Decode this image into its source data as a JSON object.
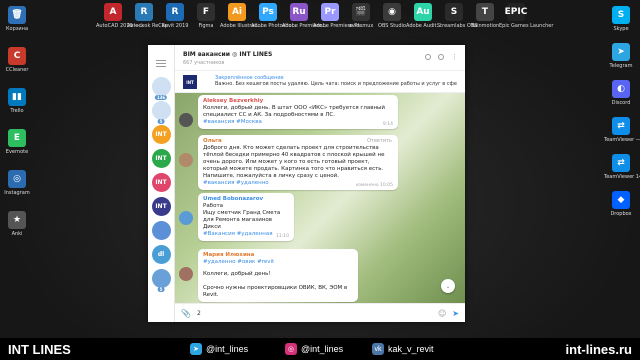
{
  "desktop_left": [
    {
      "label": "Корзина",
      "glyph": "🗑",
      "color": "#2e6fb5"
    },
    {
      "label": "CCleaner",
      "glyph": "C",
      "color": "#c83b2c"
    },
    {
      "label": "Trello",
      "glyph": "▮▮",
      "color": "#0079bf"
    },
    {
      "label": "Evernote",
      "glyph": "E",
      "color": "#2dbe60"
    },
    {
      "label": "Instagram",
      "glyph": "◎",
      "color": "#2b6cb0"
    },
    {
      "label": "Anki",
      "glyph": "★",
      "color": "#555"
    }
  ],
  "desktop_top": [
    {
      "label": "AutoCAD 2019 —...",
      "glyph": "A",
      "color": "#c1272d"
    },
    {
      "label": "Autodesk ReCap",
      "glyph": "R",
      "color": "#2a7ab5"
    },
    {
      "label": "Revit 2019",
      "glyph": "R",
      "color": "#1d6ab5"
    },
    {
      "label": "Figma",
      "glyph": "F",
      "color": "#2f2f2f"
    },
    {
      "label": "Adobe Illustrat...",
      "glyph": "Ai",
      "color": "#f29a1f"
    },
    {
      "label": "Adobe Photosho...",
      "glyph": "Ps",
      "color": "#31a8ff"
    },
    {
      "label": "Adobe Premiere...",
      "glyph": "Ru",
      "color": "#8b56c7"
    },
    {
      "label": "Adobe Premiere Pr...",
      "glyph": "Pr",
      "color": "#9999ff"
    },
    {
      "label": "avidemux",
      "glyph": "🎬",
      "color": "#333"
    },
    {
      "label": "OBS Studio",
      "glyph": "◉",
      "color": "#3a3a3a"
    },
    {
      "label": "Adobe Audit...",
      "glyph": "Au",
      "color": "#2dd4a8"
    },
    {
      "label": "Streamlabs OBS",
      "glyph": "S",
      "color": "#2a2a2a"
    },
    {
      "label": "Twinmotion",
      "glyph": "T",
      "color": "#444"
    },
    {
      "label": "Epic Games Launcher",
      "glyph": "EPIC",
      "color": "#222"
    }
  ],
  "desktop_right": [
    {
      "label": "Skype",
      "glyph": "S",
      "color": "#00aff0"
    },
    {
      "label": "Telegram",
      "glyph": "➤",
      "color": "#2ca5e0"
    },
    {
      "label": "Discord",
      "glyph": "◐",
      "color": "#5865f2"
    },
    {
      "label": "TeamViewer — ярлык",
      "glyph": "⇄",
      "color": "#0e8ee9"
    },
    {
      "label": "TeamViewer 14",
      "glyph": "⇄",
      "color": "#0e8ee9"
    },
    {
      "label": "Dropbox",
      "glyph": "◆",
      "color": "#0061ff"
    }
  ],
  "telegram": {
    "chat_title": "BIM вакансии ◎ INT LINES",
    "members": "667 участников",
    "pinned_label": "Закреплённое сообщение",
    "pinned_text": "Важно. Без кешегов посты удаляю. Цель чата: поиск и предложение работы и услуг в сфе...",
    "pinned_avatar": "INT",
    "folders": [
      {
        "text": "",
        "color": "#cfe0f3",
        "count": "136"
      },
      {
        "text": "",
        "color": "#cfe0f3",
        "count": "5"
      },
      {
        "text": "INT",
        "color": "#f4a020",
        "count": ""
      },
      {
        "text": "INT",
        "color": "#2ba84a",
        "count": ""
      },
      {
        "text": "INT",
        "color": "#e0456b",
        "count": ""
      },
      {
        "text": "INT",
        "color": "#3a3a8c",
        "count": ""
      },
      {
        "text": "",
        "color": "#5b8fd8",
        "count": ""
      },
      {
        "text": "dl",
        "color": "#4a9ed6",
        "count": ""
      },
      {
        "text": "",
        "color": "#6aa0d8",
        "count": "5"
      }
    ],
    "messages": [
      {
        "author": "Aleksey Bezverkhiy",
        "author_color": "#d9534f",
        "text": "Коллеги, добрый день. В штат ООО «ИКС» требуется главный специалист СС и АК. За подробностями в ЛС.",
        "tags": "#вакансия #Москва",
        "time": "9:14",
        "reply": "",
        "avatar_color": "#555"
      },
      {
        "author": "Ольга",
        "author_color": "#e07a2e",
        "text": "Доброго дня. Кто может сделать проект для строительства тёплой беседки примерно 40 квадратов с плоской крышей не очень дорого. Или может у кого то есть готовый проект, который можете продать. Картинка того что нравиться есть. Напишите, пожалуйста в личку сразу с ценой.",
        "tags": "#вакансия #удаленно",
        "time": "изменено 10:05",
        "reply": "Ответить",
        "avatar_color": "#b08a6a"
      },
      {
        "author": "Umed Bobonazarov",
        "author_color": "#3a8ee6",
        "text": "Работа\nИщу сметчик Гранд Смета для Ремонта магазинов Дикси",
        "tags": "#Вакансия #удаленная",
        "time": "11:10",
        "reply": "",
        "avatar_color": "#5b9bd5"
      },
      {
        "author": "Мария Илюхина",
        "author_color": "#e07a2e",
        "text": "Коллеги, добрый день!\n\nСрочно нужны проектировщики ОВИК, ВК, ЭОМ в Revit.",
        "tags": "#удаленно #овик #revit",
        "time": "",
        "reply": "",
        "avatar_color": "#a07060"
      }
    ],
    "input_value": "2"
  },
  "bottom_bar": {
    "brand": "INT LINES",
    "telegram": "@int_lines",
    "instagram": "@int_lines",
    "vk": "kak_v_revit",
    "site": "int-lines.ru"
  }
}
